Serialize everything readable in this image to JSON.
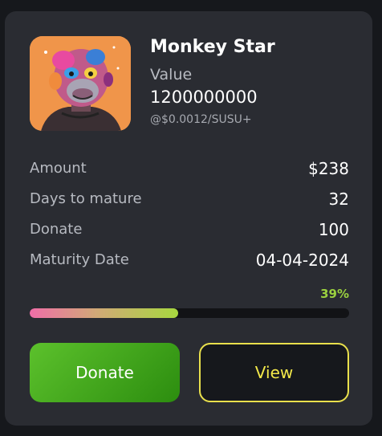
{
  "card": {
    "title": "Monkey Star",
    "value_label": "Value",
    "value_amount": "1200000000",
    "rate": "@$0.0012/SUSU+",
    "image_icon": "monkey-nft-art"
  },
  "details": [
    {
      "label": "Amount",
      "value": "$238"
    },
    {
      "label": "Days to mature",
      "value": "32"
    },
    {
      "label": "Donate",
      "value": "100"
    },
    {
      "label": "Maturity Date",
      "value": "04-04-2024"
    }
  ],
  "progress": {
    "label": "39%",
    "fraction": 0.465
  },
  "buttons": {
    "donate": "Donate",
    "view": "View"
  },
  "colors": {
    "accent_green": "#9bd13f",
    "view_yellow": "#f3e94a"
  }
}
